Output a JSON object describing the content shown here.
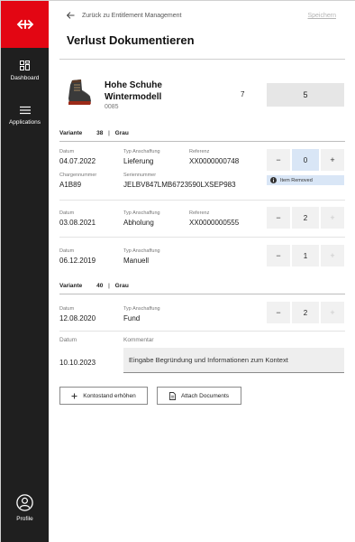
{
  "sidebar": {
    "brand_icon": "sbb-logo-icon",
    "brand_color": "#e30613",
    "items": [
      {
        "label": "Dashboard",
        "icon": "dashboard-icon"
      },
      {
        "label": "Applications",
        "icon": "menu-icon"
      }
    ],
    "profile": {
      "label": "Profile",
      "icon": "user-icon"
    }
  },
  "header": {
    "back_label": "Zurück zu Entitlement Management",
    "save_label": "Speichern",
    "title": "Verlust Dokumentieren"
  },
  "product": {
    "name": "Hohe Schuhe Wintermodell",
    "sku": "0085",
    "quantity": "7",
    "total": "5",
    "image": "boot-icon"
  },
  "variants": [
    {
      "label": "Variante",
      "size": "38",
      "color": "Grau",
      "rows": [
        {
          "datum_label": "Datum",
          "datum": "04.07.2022",
          "typ_label": "Typ Anschaffung",
          "typ": "Lieferung",
          "referenz_label": "Referenz",
          "referenz": "XX0000000748",
          "charge_label": "Chargennummer",
          "charge": "A1B89",
          "serie_label": "Seriennummer",
          "serie": "JELBV847LMB6723590LXSEP983",
          "value": "0",
          "notice": "Item Removed"
        },
        {
          "datum_label": "Datum",
          "datum": "03.08.2021",
          "typ_label": "Typ Anschaffung",
          "typ": "Abholung",
          "referenz_label": "Referenz",
          "referenz": "XX0000000555",
          "value": "2"
        },
        {
          "datum_label": "Datum",
          "datum": "06.12.2019",
          "typ_label": "Typ Anschaffung",
          "typ": "Manuell",
          "value": "1"
        }
      ]
    },
    {
      "label": "Variante",
      "size": "40",
      "color": "Grau",
      "rows": [
        {
          "datum_label": "Datum",
          "datum": "12.08.2020",
          "typ_label": "Typ Anschaffung",
          "typ": "Fund",
          "value": "2"
        }
      ]
    }
  ],
  "comment": {
    "datum_label": "Datum",
    "datum": "10.10.2023",
    "label": "Kommentar",
    "placeholder": "Eingabe Begründung und Informationen zum Kontext"
  },
  "actions": {
    "increase_label": "Kontostand erhöhen",
    "attach_label": "Attach Documents"
  },
  "stepper": {
    "minus": "−",
    "plus": "+"
  }
}
